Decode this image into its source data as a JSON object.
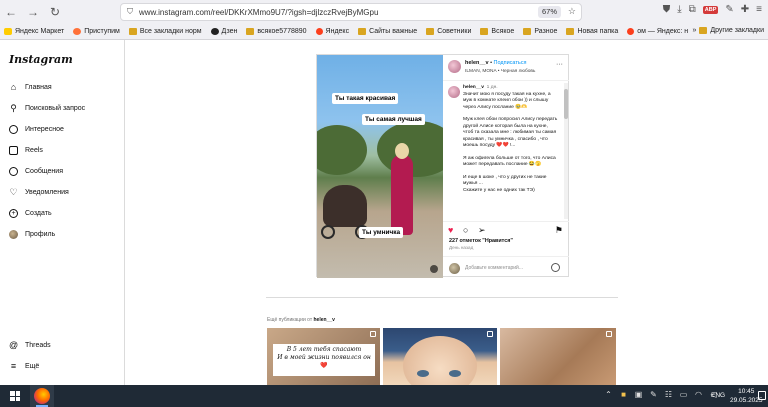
{
  "browser": {
    "url": "www.instagram.com/reel/DKKrXMmo9U7/?igsh=djlzczRvejByMGpu",
    "zoom": "67%",
    "abp_label": "ABP"
  },
  "bookmarks": [
    {
      "label": "Яндекс Маркет",
      "icon": "market-icon"
    },
    {
      "label": "Приступим",
      "icon": "firefox-icon"
    },
    {
      "label": "Все закладки норм",
      "icon": "folder-icon"
    },
    {
      "label": "Дзен",
      "icon": "dzen-icon"
    },
    {
      "label": "всякое5778890",
      "icon": "folder-icon"
    },
    {
      "label": "Яндекс",
      "icon": "yandex-icon"
    },
    {
      "label": "Сайты важные",
      "icon": "folder-icon"
    },
    {
      "label": "Советники",
      "icon": "folder-icon"
    },
    {
      "label": "Всякое",
      "icon": "folder-icon"
    },
    {
      "label": "Разное",
      "icon": "folder-icon"
    },
    {
      "label": "Новая папка",
      "icon": "folder-icon"
    },
    {
      "label": "ом — Яндекс: нашло...",
      "icon": "yandex-icon"
    }
  ],
  "bookmarks_other": "Другие закладки",
  "sidebar": {
    "logo": "Instagram",
    "items": [
      {
        "label": "Главная",
        "icon": "home-icon"
      },
      {
        "label": "Поисковый запрос",
        "icon": "search-icon"
      },
      {
        "label": "Интересное",
        "icon": "compass-icon"
      },
      {
        "label": "Reels",
        "icon": "reels-icon"
      },
      {
        "label": "Сообщения",
        "icon": "messenger-icon"
      },
      {
        "label": "Уведомления",
        "icon": "heart-icon"
      },
      {
        "label": "Создать",
        "icon": "plus-icon"
      },
      {
        "label": "Профиль",
        "icon": "avatar-icon"
      }
    ],
    "bottom_items": [
      {
        "label": "Threads",
        "icon": "threads-icon"
      },
      {
        "label": "Ещё",
        "icon": "menu-icon"
      }
    ]
  },
  "post": {
    "captions": [
      "Ты такая красивая",
      "Ты самая лучшая",
      "Ты умничка"
    ],
    "header": {
      "username": "helen__v",
      "separator": " • ",
      "follow": "Подписаться",
      "song": "ILMAN, MONA • Черная любовь"
    },
    "comment": {
      "username": "helen__v",
      "time": "1 дн.",
      "paragraphs": [
        "Значит мою я посуду такая на кухне, а муж в комнате клеил обои )) и слышу через Алису послание 🥹🫶",
        "Муж клея обои попросил Алису передать другой Алисе которая была на кухне, чтоб та сказала мне : любимая ты самая красивая , ты умничка , спасибо , что моешь посуду ❤️❤️ !...",
        "Я аж офигела больше от того, что Алиса может передавать послание 😂🫣",
        "И еще в шоке , что у других не такие мужья ...\nСкажите у нас не одних так ТЭ)"
      ]
    },
    "likes": "227 отметок \"Нравится\"",
    "date": "День назад",
    "comment_placeholder": "Добавьте комментарий..."
  },
  "more": {
    "prefix": "Ещё публикации от ",
    "username": "helen__v",
    "thumb1_lines": [
      "В 5 лет тебя спасают",
      "И в моей жизни появился он",
      "❤️"
    ]
  },
  "taskbar": {
    "lang": "ENG",
    "time": "10:45",
    "date": "29.05.2025"
  }
}
